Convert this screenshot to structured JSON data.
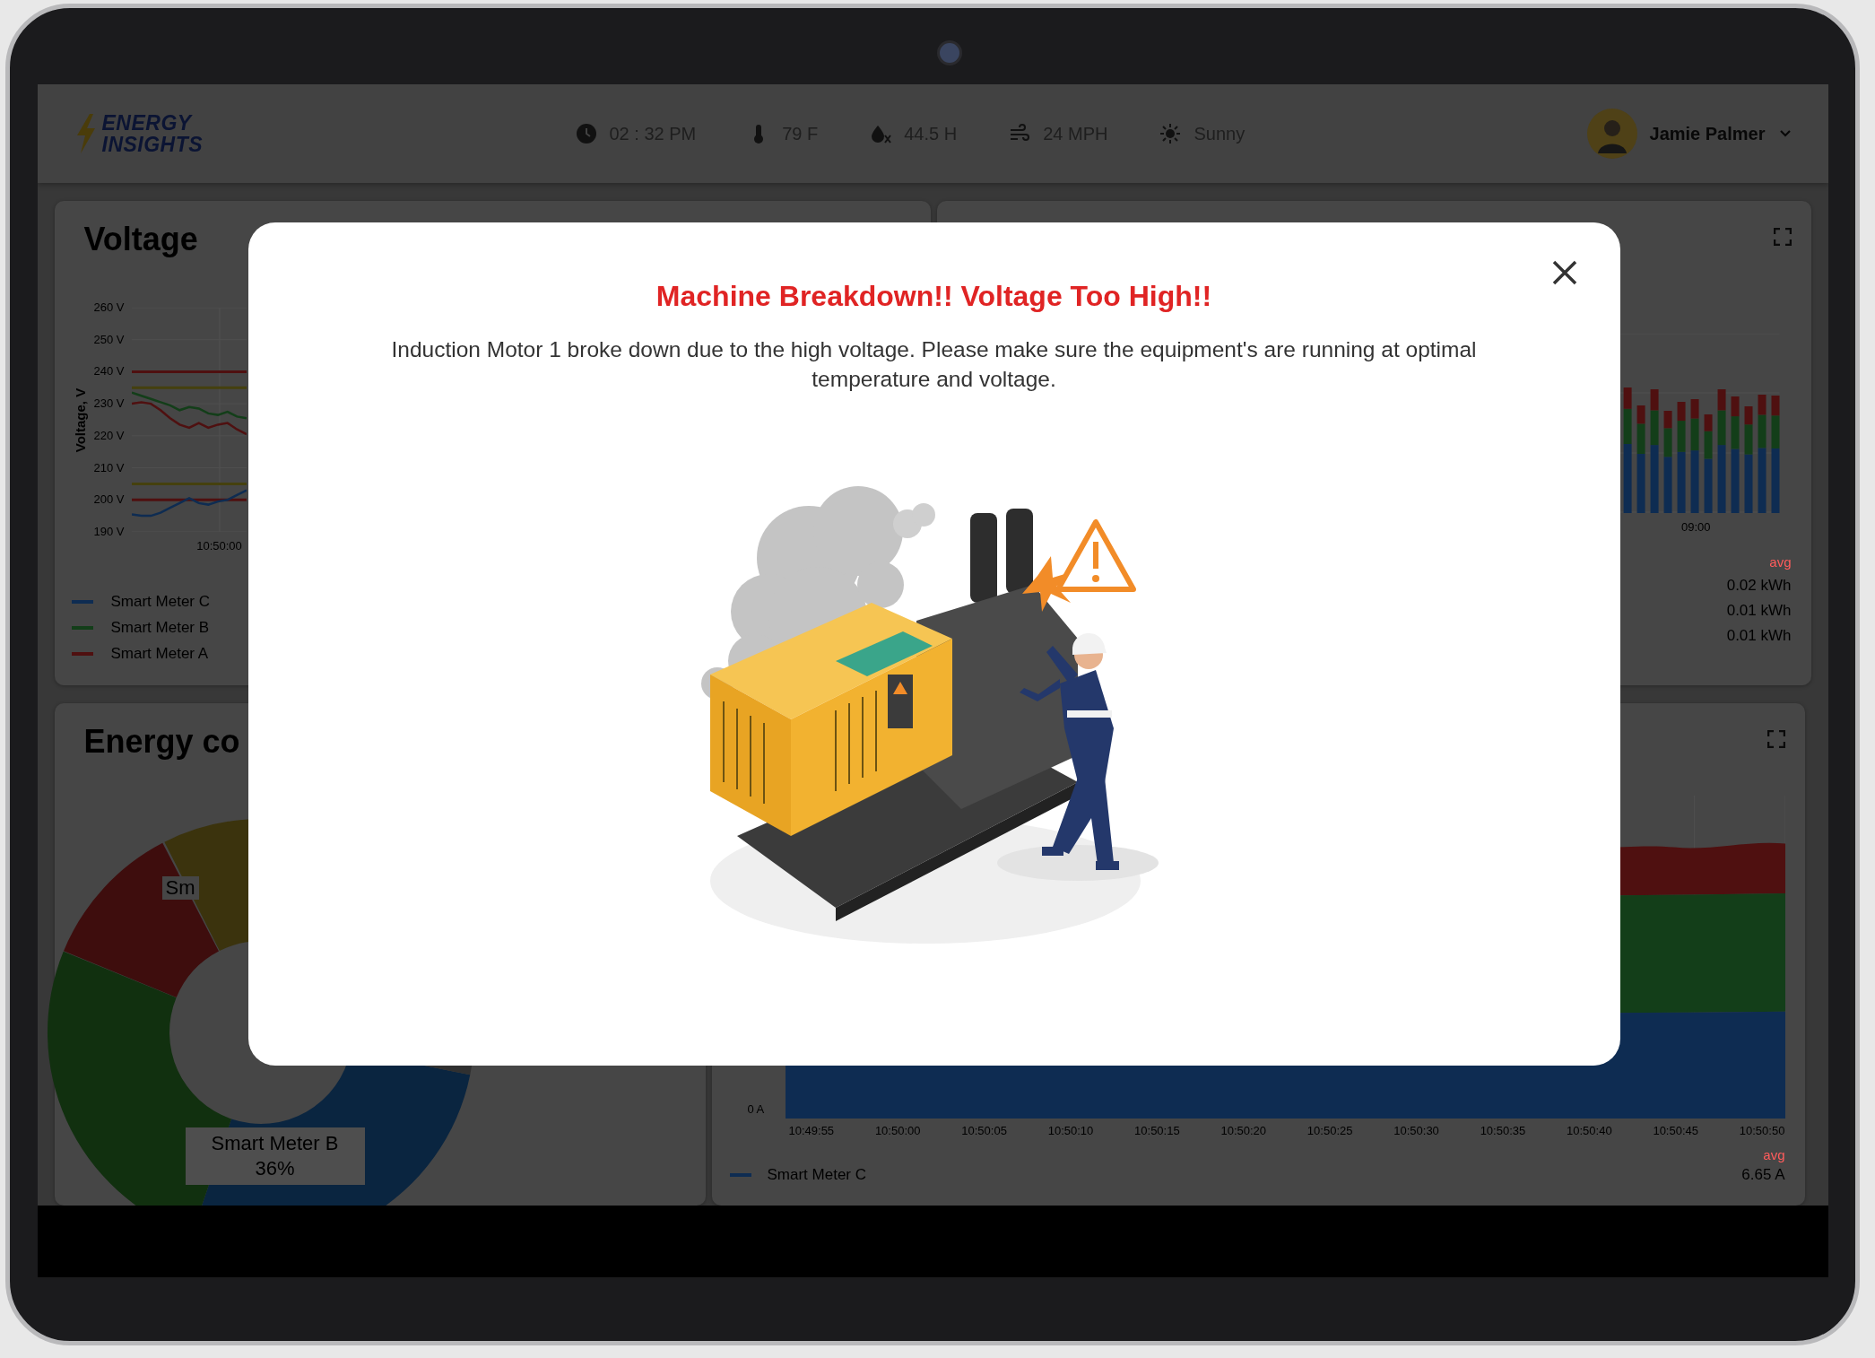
{
  "header": {
    "logo": {
      "line_1": "ENERGY",
      "line_2": "INSIGHTS"
    },
    "weather": [
      {
        "kind": "time",
        "text": "02 : 32 PM"
      },
      {
        "kind": "temperature",
        "text": "79 F"
      },
      {
        "kind": "humidity",
        "text": "44.5 H"
      },
      {
        "kind": "wind",
        "text": "24 MPH"
      },
      {
        "kind": "condition",
        "text": "Sunny"
      }
    ],
    "user": {
      "name": "Jamie Palmer"
    }
  },
  "voltage_panel": {
    "title": "Voltage",
    "chart_data": {
      "type": "line",
      "ylabel": "Voltage, V",
      "grid": true,
      "categories": [
        null,
        null,
        null,
        null,
        null,
        null,
        null,
        null,
        null,
        null,
        null,
        null,
        null
      ],
      "ylim": [
        190,
        260
      ],
      "yticks": [
        {
          "value": 260,
          "label": "260 V"
        },
        {
          "value": 250,
          "label": "250 V"
        },
        {
          "value": 240,
          "label": "240 V"
        },
        {
          "value": 230,
          "label": "230 V"
        },
        {
          "value": 220,
          "label": "220 V"
        },
        {
          "value": 210,
          "label": "210 V"
        },
        {
          "value": 200,
          "label": "200 V"
        },
        {
          "value": 190,
          "label": "190 V"
        }
      ],
      "series": [
        {
          "name": "Smart Meter C",
          "color": "#0e2c52",
          "values": [
            195.5,
            195,
            195,
            196,
            197.5,
            199,
            200.5,
            199,
            198.5,
            199.5,
            200,
            201.5,
            203
          ]
        },
        {
          "name": "Smart Meter B",
          "color": "#133e19",
          "values": [
            233.5,
            232.5,
            231.5,
            230.5,
            229.5,
            228,
            229,
            228.5,
            227,
            226.5,
            227.5,
            226,
            225.5
          ]
        },
        {
          "name": "Smart Meter A",
          "color": "#4f1010",
          "values": [
            230,
            230.5,
            230,
            228,
            225.5,
            223.5,
            222.5,
            224,
            222.5,
            223.5,
            224,
            222,
            220.5
          ]
        },
        {
          "color": "#4f1010",
          "values": [
            240,
            240,
            240,
            240,
            240,
            240,
            240,
            240,
            240,
            240,
            240,
            240,
            240
          ]
        },
        {
          "color": "#45400e",
          "values": [
            235,
            235,
            235,
            235,
            235,
            235,
            235,
            235,
            235,
            235,
            235,
            235,
            235
          ]
        },
        {
          "color": "#45400e",
          "values": [
            205,
            205,
            205,
            205,
            205,
            205,
            205,
            205,
            205,
            205,
            205,
            205,
            205
          ]
        },
        {
          "color": "#4f1010",
          "values": [
            200,
            200,
            200,
            200,
            200,
            200,
            200,
            200,
            200,
            200,
            200,
            200,
            200
          ]
        }
      ],
      "annotations": [
        {
          "text": "10:50:00"
        }
      ]
    }
  },
  "energy_bar_panel": {
    "x_tick_labels": [
      "09:00"
    ],
    "avg_label": "avg",
    "readings": [
      "0.02 kWh",
      "0.01 kWh",
      "0.01 kWh"
    ]
  },
  "energy_consumption_panel": {
    "title": "Energy co",
    "slice_labels": [
      {
        "name": "Sm"
      },
      {
        "name": "Smart Meter B",
        "share": "36%"
      }
    ]
  },
  "current_panel": {
    "y_tick_labels": [
      "0 A"
    ],
    "x_tick_labels": [
      "10:49:55",
      "10:50:00",
      "10:50:05",
      "10:50:10",
      "10:50:15",
      "10:50:20",
      "10:50:25",
      "10:50:30",
      "10:50:35",
      "10:50:40",
      "10:50:45",
      "10:50:50"
    ],
    "avg_label": "avg",
    "legend": [
      {
        "name": "Smart Meter C",
        "color": "#0e2c52",
        "reading": "6.65 A"
      }
    ]
  },
  "alert_dialog": {
    "title": "Machine Breakdown!! Voltage Too High!!",
    "message": "Induction Motor 1 broke down due to the high voltage. Please make sure the equipment's are running at optimal temperature and voltage."
  }
}
